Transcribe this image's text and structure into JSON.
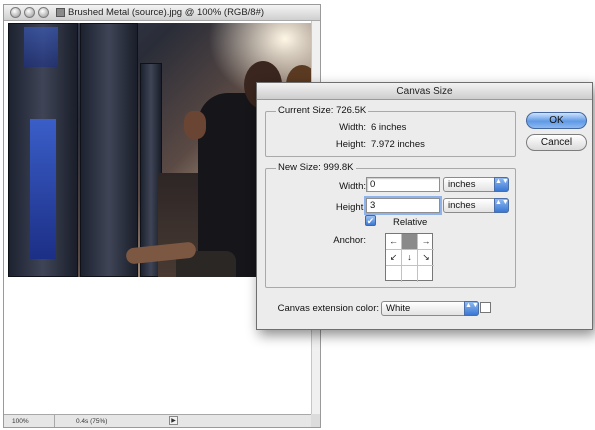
{
  "document": {
    "title": "Brushed Metal (source).jpg @ 100% (RGB/8#)",
    "zoom": "100%",
    "doc_info": "0.4s (75%)",
    "status_arrow": "▶"
  },
  "dialog": {
    "title": "Canvas Size",
    "current_size": {
      "legend": "Current Size: 726.5K",
      "width_label": "Width:",
      "width_value": "6 inches",
      "height_label": "Height:",
      "height_value": "7.972 inches"
    },
    "new_size": {
      "legend": "New Size: 999.8K",
      "width_label": "Width:",
      "width_value": "0",
      "width_unit": "inches",
      "height_label": "Height:",
      "height_value": "3",
      "height_unit": "inches",
      "relative_label": "Relative",
      "relative_checked": "✔",
      "anchor_label": "Anchor:",
      "anchor_arrows": [
        "←",
        "",
        "→",
        "↙",
        "↓",
        "↘",
        "",
        "",
        ""
      ]
    },
    "extension": {
      "label": "Canvas extension color:",
      "value": "White"
    },
    "ok_label": "OK",
    "cancel_label": "Cancel",
    "select_arrows": "▲▼"
  },
  "colors": {
    "accent": "#3a78d4",
    "dialog_bg": "#ececec"
  }
}
